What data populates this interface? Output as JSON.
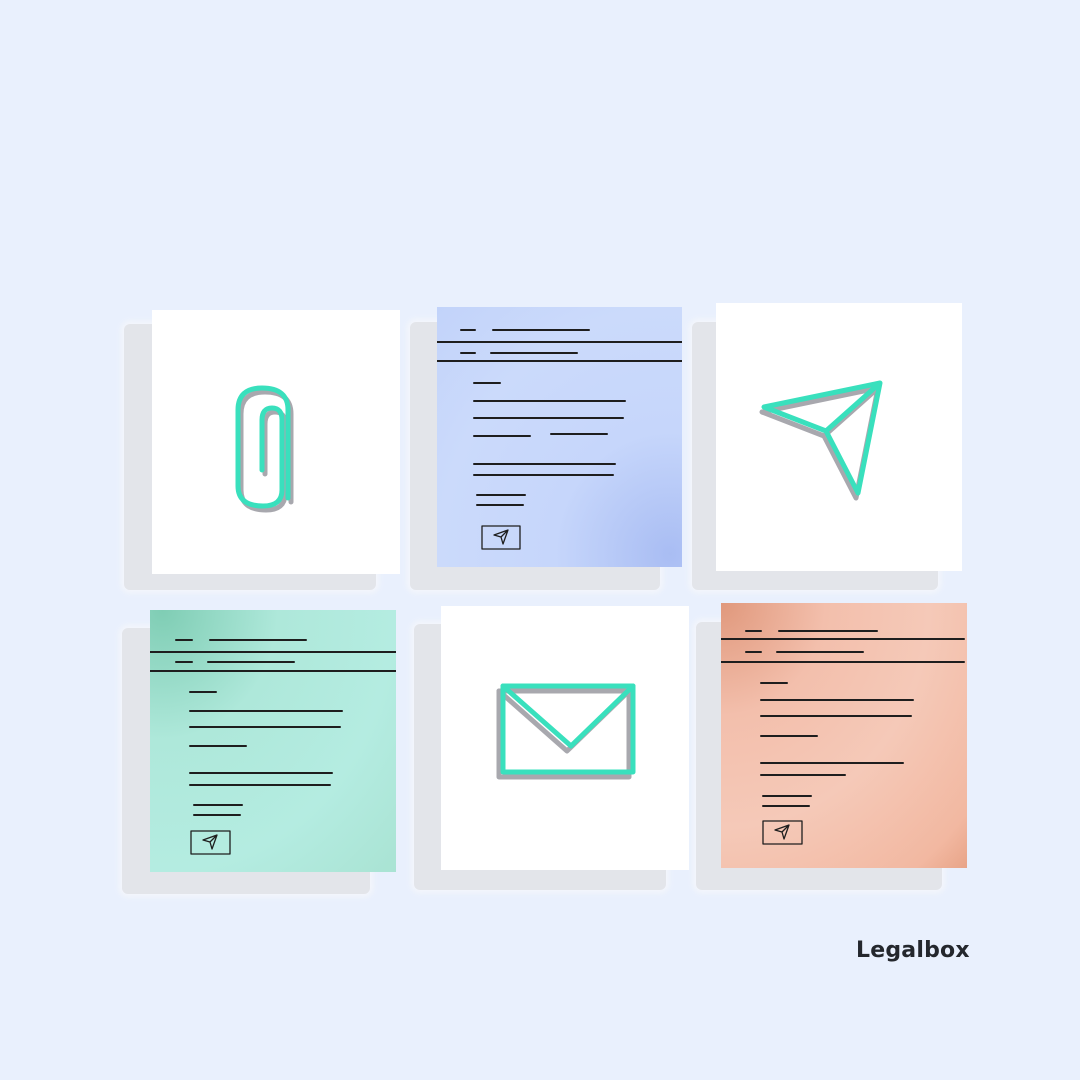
{
  "brand": {
    "name": "Legalbox"
  },
  "colors": {
    "background": "#e9f0fd",
    "accent": "#39e0bd",
    "accent_shadow": "#a8a8ae",
    "blue_card": "#c6d6fb",
    "mint_card": "#b4ece1",
    "peach_card": "#f5c9b8",
    "line_ink": "#1e1e1e"
  },
  "cards": [
    {
      "kind": "icon",
      "icon": "paperclip-icon",
      "fill": "white"
    },
    {
      "kind": "document",
      "icon": "send-icon",
      "fill": "blue"
    },
    {
      "kind": "icon",
      "icon": "paper-plane-icon",
      "fill": "white"
    },
    {
      "kind": "document",
      "icon": "send-icon",
      "fill": "mint"
    },
    {
      "kind": "icon",
      "icon": "envelope-icon",
      "fill": "white"
    },
    {
      "kind": "document",
      "icon": "send-icon",
      "fill": "peach"
    }
  ]
}
